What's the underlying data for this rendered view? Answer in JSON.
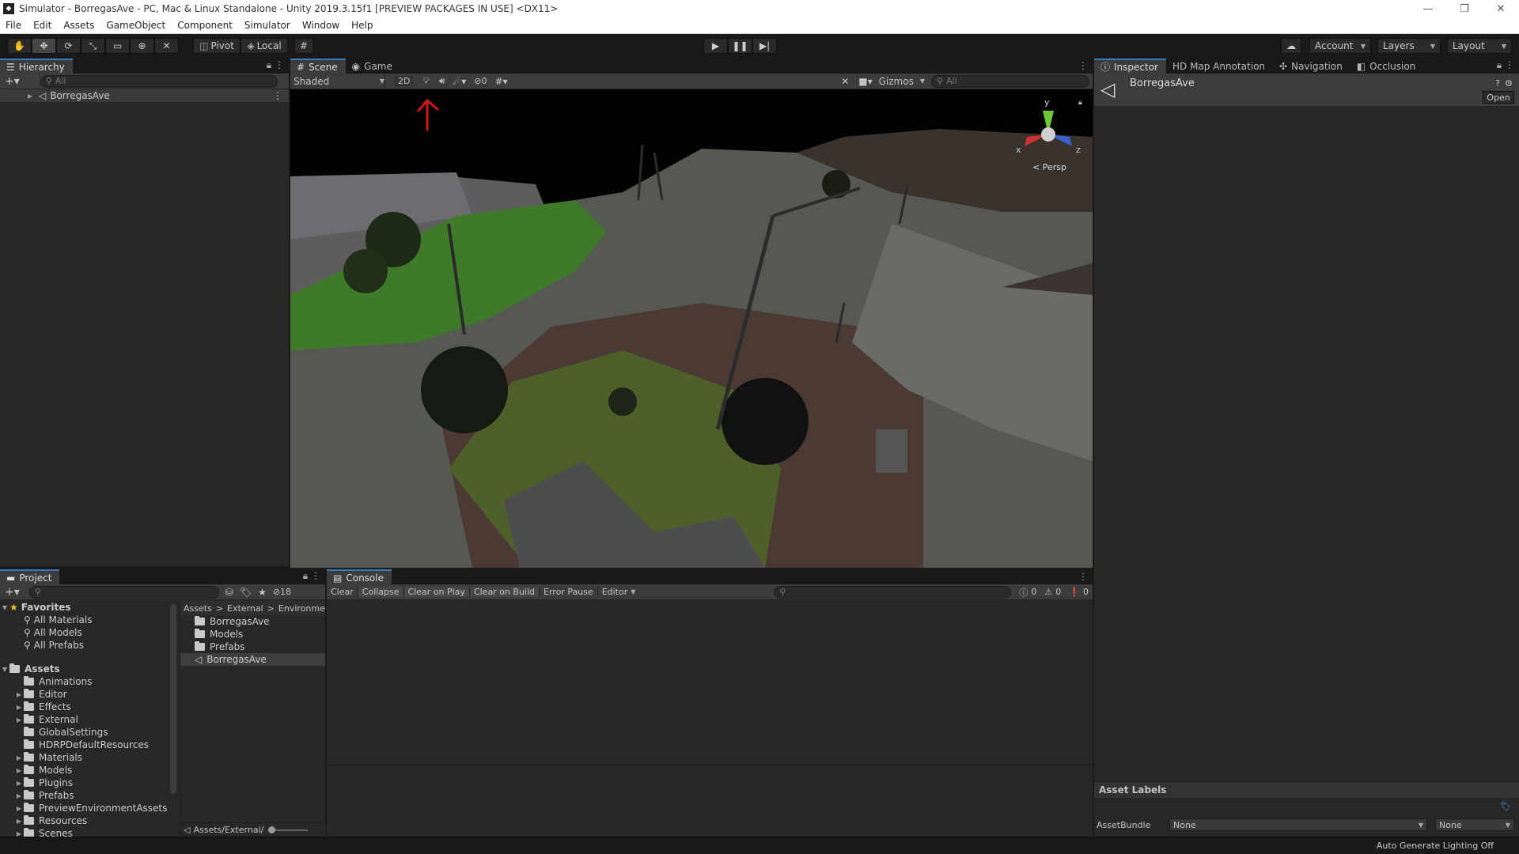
{
  "window": {
    "title": "Simulator - BorregasAve - PC, Mac & Linux Standalone - Unity 2019.3.15f1 [PREVIEW PACKAGES IN USE] <DX11>",
    "controls": [
      "—",
      "❐",
      "✕"
    ]
  },
  "menu": [
    "File",
    "Edit",
    "Assets",
    "GameObject",
    "Component",
    "Simulator",
    "Window",
    "Help"
  ],
  "toolbar": {
    "pivot": "Pivot",
    "local": "Local",
    "account": "Account",
    "layers": "Layers",
    "layout": "Layout"
  },
  "hierarchy": {
    "tab": "Hierarchy",
    "search_placeholder": "All",
    "root_item": "BorregasAve"
  },
  "scene": {
    "tabs": [
      "Scene",
      "Game"
    ],
    "shading_mode": "Shaded",
    "mode_2d": "2D",
    "hidden_count": "0",
    "gizmos": "Gizmos",
    "search_placeholder": "All",
    "projection": "Persp",
    "axes": {
      "x": "x",
      "y": "y",
      "z": "z"
    }
  },
  "inspector": {
    "tabs": [
      "Inspector",
      "HD Map Annotation",
      "Navigation",
      "Occlusion"
    ],
    "object_name": "BorregasAve",
    "open_button": "Open",
    "asset_labels": "Asset Labels",
    "assetbundle_label": "AssetBundle",
    "assetbundle_value": "None",
    "assetbundle_variant": "None"
  },
  "project": {
    "tab": "Project",
    "hidden_count": "18",
    "favorites_label": "Favorites",
    "favorites": [
      "All Materials",
      "All Models",
      "All Prefabs"
    ],
    "assets_label": "Assets",
    "asset_folders": [
      "Animations",
      "Editor",
      "Effects",
      "External",
      "GlobalSettings",
      "HDRPDefaultResources",
      "Materials",
      "Models",
      "Plugins",
      "Prefabs",
      "PreviewEnvironmentAssets",
      "Resources",
      "Scenes"
    ],
    "breadcrumb": [
      "Assets",
      "External",
      "Environmen"
    ],
    "contents": [
      "BorregasAve",
      "Models",
      "Prefabs",
      "BorregasAve"
    ],
    "path": "Assets/External/"
  },
  "console": {
    "tab": "Console",
    "buttons": [
      "Clear",
      "Collapse",
      "Clear on Play",
      "Clear on Build",
      "Error Pause",
      "Editor"
    ],
    "log_count": "0",
    "warn_count": "0",
    "error_count": "0"
  },
  "status": {
    "lighting": "Auto Generate Lighting Off"
  },
  "colors": {
    "accent": "#3a79bb",
    "panel": "#282828",
    "header": "#3c3c3c"
  }
}
